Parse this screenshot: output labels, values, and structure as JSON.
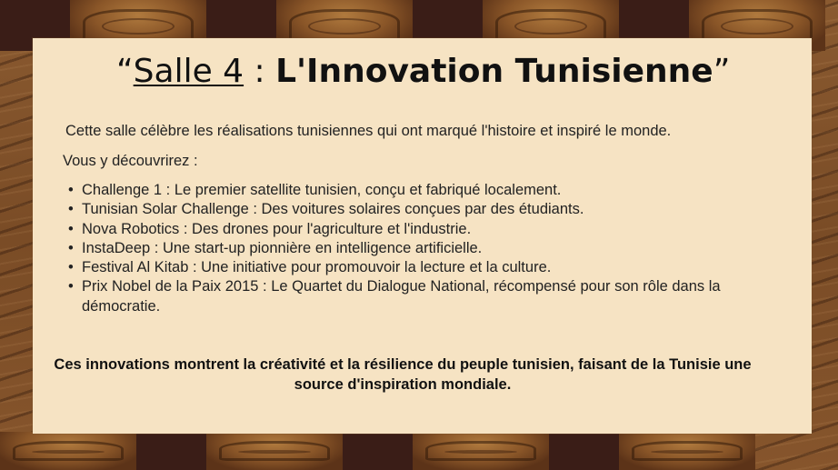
{
  "slide": {
    "title": {
      "open_quote": "“",
      "room": "Salle 4",
      "separator": " : ",
      "topic": "L'Innovation Tunisienne",
      "close_quote": "”"
    },
    "intro": "Cette salle célèbre les réalisations tunisiennes qui ont marqué l'histoire et inspiré le monde.",
    "lead": "Vous y découvrirez :",
    "items": [
      "Challenge 1 : Le premier satellite tunisien, conçu et fabriqué localement.",
      "Tunisian Solar Challenge : Des voitures solaires conçues par des étudiants.",
      "Nova Robotics : Des drones pour l'agriculture et l'industrie.",
      "InstaDeep : Une start-up pionnière en intelligence artificielle.",
      "Festival Al Kitab : Une initiative pour promouvoir la lecture et la culture.",
      "Prix Nobel de la Paix 2015 : Le Quartet du Dialogue National, récompensé pour son rôle dans la démocratie."
    ],
    "closing": "Ces innovations montrent la créativité et la résilience du peuple tunisien, faisant de la Tunisie une source d'inspiration mondiale."
  },
  "colors": {
    "card": "#f6e3c3",
    "wood": "#7a4e28",
    "column_dark": "#3a1d17",
    "text": "#111111"
  }
}
